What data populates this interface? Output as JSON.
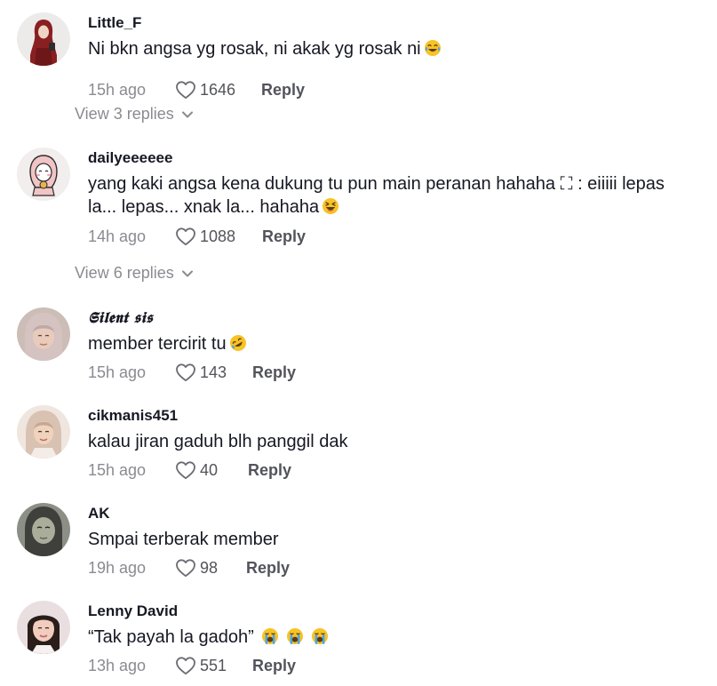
{
  "comments": [
    {
      "username": "Little_F",
      "text": "Ni bkn angsa yg rosak, ni akak yg rosak ni",
      "emoji": [
        "face-with-tears-of-joy-icon"
      ],
      "time": "15h ago",
      "likes": "1646",
      "reply_label": "Reply",
      "view_replies": "View 3 replies"
    },
    {
      "username": "dailyeeeeee",
      "text": "yang kaki angsa kena dukung tu pun main peranan hahaha ⛶ : eiiiii lepas la... lepas... xnak la... hahaha",
      "emoji": [
        "grinning-squinting-face-icon"
      ],
      "time": "14h ago",
      "likes": "1088",
      "reply_label": "Reply",
      "view_replies": "View 6 replies"
    },
    {
      "username": "𝕾𝖎𝖑𝖊𝖓𝖙 𝖘𝖎𝖘",
      "text": "member tercirit tu",
      "emoji": [
        "rolling-on-floor-laughing-icon"
      ],
      "time": "15h ago",
      "likes": "143",
      "reply_label": "Reply"
    },
    {
      "username": "cikmanis451",
      "text": "kalau jiran gaduh blh panggil dak",
      "time": "15h ago",
      "likes": "40",
      "reply_label": "Reply"
    },
    {
      "username": "AK",
      "text": "Smpai terberak member",
      "time": "19h ago",
      "likes": "98",
      "reply_label": "Reply"
    },
    {
      "username": "Lenny David",
      "text": "“Tak payah la gadoh”",
      "emoji": [
        "loudly-crying-face-icon",
        "loudly-crying-face-icon",
        "loudly-crying-face-icon"
      ],
      "time": "13h ago",
      "likes": "551",
      "reply_label": "Reply"
    }
  ],
  "colors": {
    "primary_text": "#161823",
    "secondary_text": "#8a8b91",
    "action_text": "#53545b",
    "emoji_yellow": "#f7c325",
    "emoji_tear_blue": "#4aa3f0"
  }
}
